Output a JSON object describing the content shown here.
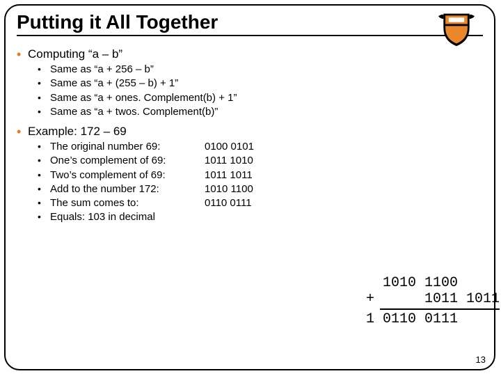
{
  "title": "Putting it All Together",
  "b1": {
    "head": "Computing “a – b”",
    "s1": "Same as “a + 256 – b”",
    "s2": "Same as “a + (255 – b) + 1”",
    "s3": "Same as “a + ones. Complement(b) + 1”",
    "s4": "Same as “a + twos. Complement(b)”"
  },
  "b2": {
    "head": "Example: 172 – 69",
    "r1": {
      "label": "The original number 69:",
      "bin": "0100 0101"
    },
    "r2": {
      "label": "One’s complement of 69:",
      "bin": "1011 1010"
    },
    "r3": {
      "label": "Two’s complement of 69:",
      "bin": "1011 1011"
    },
    "r4": {
      "label": "Add to the number 172:",
      "bin": "1010 1100"
    },
    "r5": {
      "label": "The sum comes to:",
      "bin": "0110 0111"
    },
    "r6": {
      "label": "Equals: 103 in decimal",
      "bin": ""
    }
  },
  "calc": {
    "line1": "  1010 1100",
    "line2": "+      1011 1011",
    "line3": "1 0110 0111"
  },
  "page": "13"
}
